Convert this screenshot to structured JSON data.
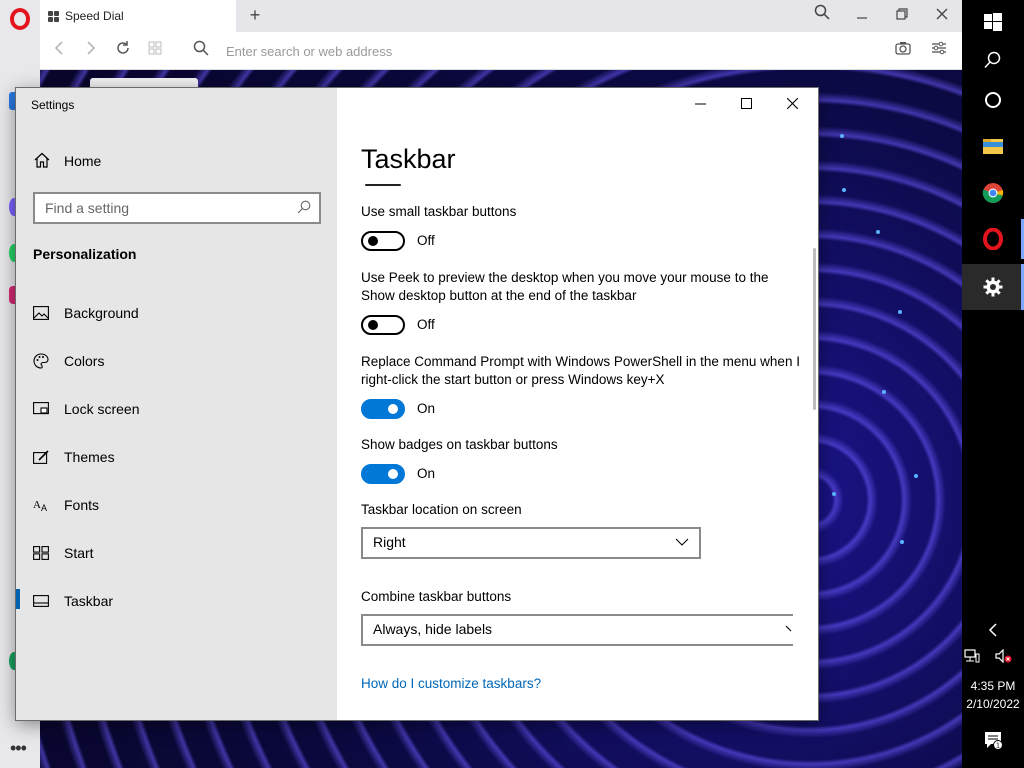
{
  "browser": {
    "tab_title": "Speed Dial",
    "new_tab_symbol": "+",
    "address_placeholder": "Enter search or web address",
    "more_symbol": "•••"
  },
  "settings": {
    "window_title": "Settings",
    "nav": {
      "home_label": "Home",
      "search_placeholder": "Find a setting",
      "section_heading": "Personalization",
      "items": [
        {
          "label": "Background",
          "icon": "background-icon"
        },
        {
          "label": "Colors",
          "icon": "palette-icon"
        },
        {
          "label": "Lock screen",
          "icon": "lock-screen-icon"
        },
        {
          "label": "Themes",
          "icon": "themes-icon"
        },
        {
          "label": "Fonts",
          "icon": "fonts-icon"
        },
        {
          "label": "Start",
          "icon": "start-icon"
        },
        {
          "label": "Taskbar",
          "icon": "taskbar-icon"
        }
      ],
      "selected": "Taskbar"
    },
    "page": {
      "title": "Taskbar",
      "small_buttons": {
        "label": "Use small taskbar buttons",
        "state": "Off"
      },
      "peek": {
        "label": "Use Peek to preview the desktop when you move your mouse to the Show desktop button at the end of the taskbar",
        "state": "Off"
      },
      "powershell": {
        "label": "Replace Command Prompt with Windows PowerShell in the menu when I right-click the start button or press Windows key+X",
        "state": "On"
      },
      "badges": {
        "label": "Show badges on taskbar buttons",
        "state": "On"
      },
      "location": {
        "label": "Taskbar location on screen",
        "value": "Right"
      },
      "combine": {
        "label": "Combine taskbar buttons",
        "value": "Always, hide labels"
      },
      "help_link": "How do I customize taskbars?"
    }
  },
  "taskbar": {
    "clock_time": "4:35 PM",
    "clock_date": "2/10/2022",
    "notification_count": "1"
  },
  "colors": {
    "accent": "#0078d7",
    "link": "#0067b8",
    "opera_red": "#e3141e"
  }
}
